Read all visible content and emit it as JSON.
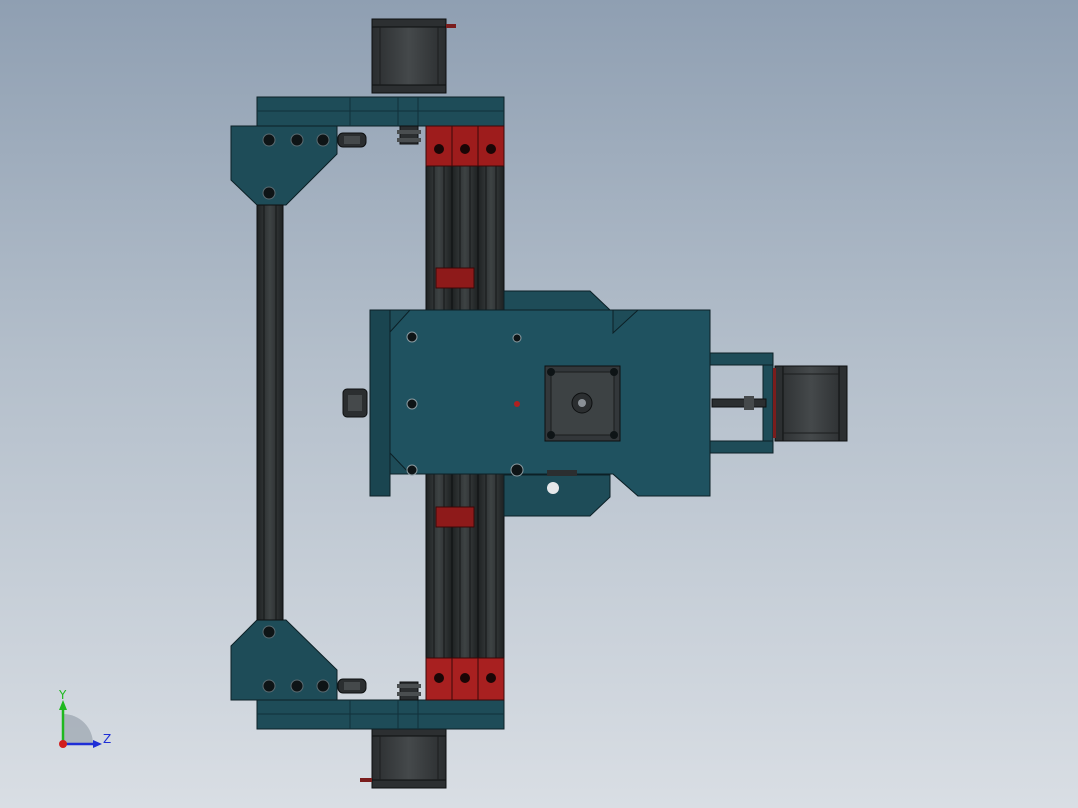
{
  "colors": {
    "frame": "#1e4c58",
    "frame_edge": "#0c2026",
    "rail": "#2e3233",
    "motor": "#3a3d3f",
    "red_block": "#9e1c1c",
    "background_top": "#8f9fb2",
    "background_bottom": "#d9dee4"
  },
  "triad": {
    "y_label": "Y",
    "z_label": "Z",
    "y_color": "#1fb81f",
    "z_color": "#1e2ed6",
    "x_color": "#d21e1e"
  },
  "icons": [
    "stepper-motor-icon",
    "pulley-icon",
    "bearing-icon",
    "axis-triad-icon"
  ]
}
